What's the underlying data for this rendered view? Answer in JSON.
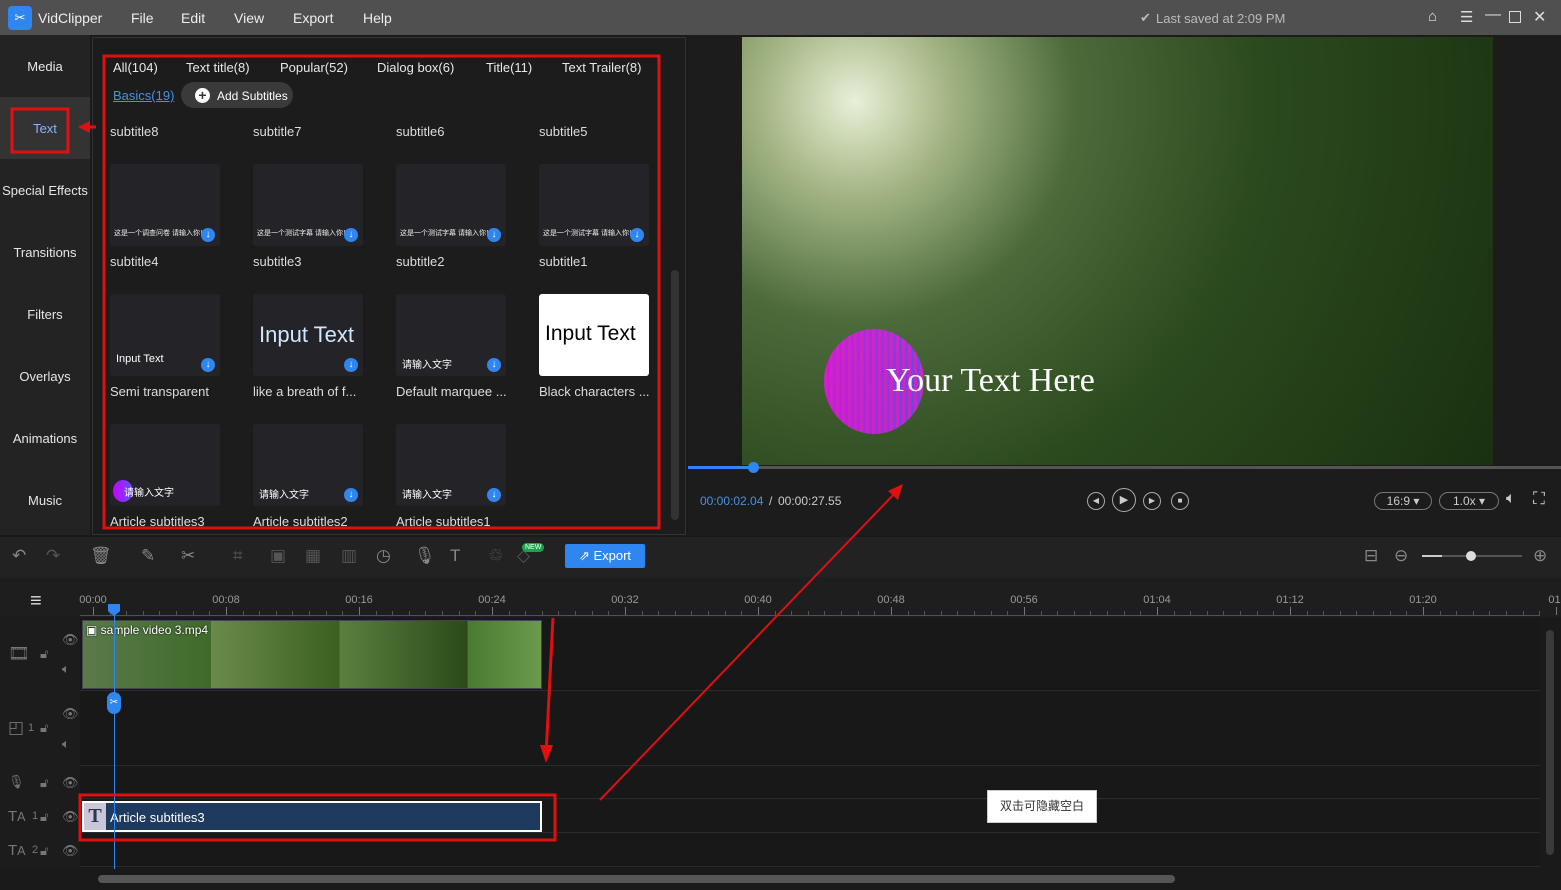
{
  "app": {
    "name": "VidClipper",
    "menu": [
      "File",
      "Edit",
      "View",
      "Export",
      "Help"
    ],
    "save_status": "Last saved at 2:09 PM"
  },
  "sidebar": {
    "items": [
      "Media",
      "Text",
      "Special Effects",
      "Transitions",
      "Filters",
      "Overlays",
      "Animations",
      "Music"
    ],
    "active": "Text"
  },
  "panel": {
    "tabs": [
      "All(104)",
      "Text title(8)",
      "Popular(52)",
      "Dialog box(6)",
      "Title(11)",
      "Text Trailer(8)"
    ],
    "active_subtab": "Basics(19)",
    "add_subtitles": "Add Subtitles",
    "row0": [
      "subtitle8",
      "subtitle7",
      "subtitle6",
      "subtitle5"
    ],
    "items": [
      {
        "name": "subtitle4",
        "preview": "这是一个调查问卷 请输入你自己的文字"
      },
      {
        "name": "subtitle3",
        "preview": "这是一个测试字幕 请输入你自己的文字"
      },
      {
        "name": "subtitle2",
        "preview": "这是一个测试字幕 请输入你自己的文字"
      },
      {
        "name": "subtitle1",
        "preview": "这是一个测试字幕 请输入你自己的文字"
      },
      {
        "name": "Semi transparent",
        "preview": "Input Text"
      },
      {
        "name": "like a breath of f...",
        "preview": "Input Text"
      },
      {
        "name": "Default marquee ...",
        "preview": "请输入文字"
      },
      {
        "name": "Black characters ...",
        "preview": "Input Text"
      },
      {
        "name": "Article subtitles3",
        "preview": "请输入文字"
      },
      {
        "name": "Article subtitles2",
        "preview": "请输入文字"
      },
      {
        "name": "Article subtitles1",
        "preview": "请输入文字"
      }
    ]
  },
  "preview": {
    "overlay_text": "Your Text Here",
    "current_time": "00:00:02.04",
    "separator": "/",
    "total_time": "00:00:27.55",
    "progress": 0.074,
    "aspect": "16:9",
    "speed": "1.0x"
  },
  "toolbar": {
    "export": "Export",
    "new_badge": "NEW",
    "zoom_level": 0.2
  },
  "timeline": {
    "ticks": [
      "00:00",
      "00:08",
      "00:16",
      "00:24",
      "00:32",
      "00:40",
      "00:48",
      "00:56",
      "01:04",
      "01:12",
      "01:20",
      "01:"
    ],
    "video_clip": "sample video 3.mp4",
    "text_clip": "Article subtitles3",
    "pip_track": "1",
    "text_track1": "1",
    "text_track2": "2",
    "tooltip": "双击可隐藏空白"
  },
  "colors": {
    "accent": "#2f86f0",
    "annotation": "#e01010",
    "clip": "#1e3a5f"
  }
}
